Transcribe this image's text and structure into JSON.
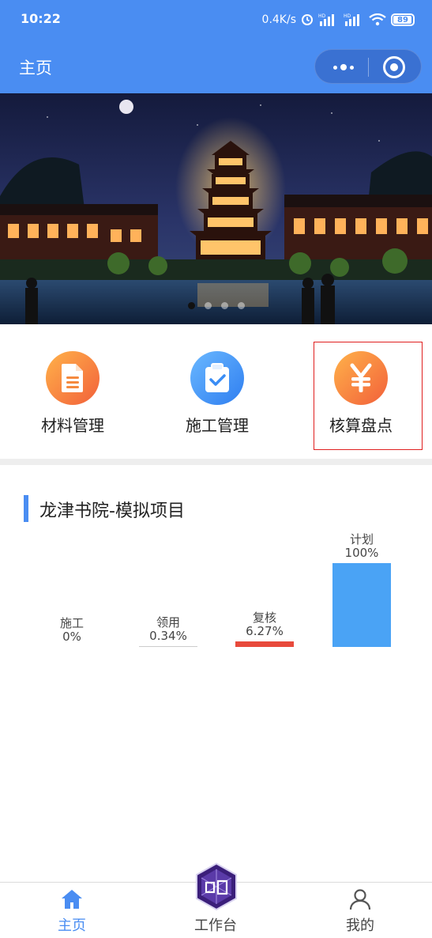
{
  "status_bar": {
    "time": "10:22",
    "network_speed": "0.4K/s",
    "battery": "89",
    "signal_badge_1": "HD",
    "signal_badge_2": "HD"
  },
  "nav": {
    "title": "主页"
  },
  "banner": {
    "slide_count": 4,
    "active_index": 0
  },
  "menu": {
    "items": [
      {
        "label": "材料管理",
        "icon": "document-icon",
        "color_from": "#ffb24a",
        "color_to": "#f2603a"
      },
      {
        "label": "施工管理",
        "icon": "clipboard-check-icon",
        "color_from": "#6ab8ff",
        "color_to": "#2f7ef0"
      },
      {
        "label": "核算盘点",
        "icon": "yen-icon",
        "color_from": "#ffb24a",
        "color_to": "#f2603a"
      }
    ]
  },
  "project": {
    "title": "龙津书院-模拟项目",
    "accent": "#4a8df2"
  },
  "chart_data": {
    "type": "bar",
    "categories": [
      "施工",
      "领用",
      "复核",
      "计划"
    ],
    "values": [
      0,
      0.34,
      6.27,
      100
    ],
    "value_labels": [
      "0%",
      "0.34%",
      "6.27%",
      "100%"
    ],
    "colors": [
      "#cccccc",
      "#cccccc",
      "#e84a3c",
      "#4aa3f5"
    ],
    "ylim": [
      0,
      100
    ]
  },
  "tabbar": {
    "items": [
      {
        "label": "主页",
        "icon": "home-icon",
        "active": true
      },
      {
        "label": "工作台",
        "icon": "workbench-logo-icon",
        "active": false
      },
      {
        "label": "我的",
        "icon": "user-icon",
        "active": false
      }
    ],
    "active_color": "#4a8df2"
  }
}
